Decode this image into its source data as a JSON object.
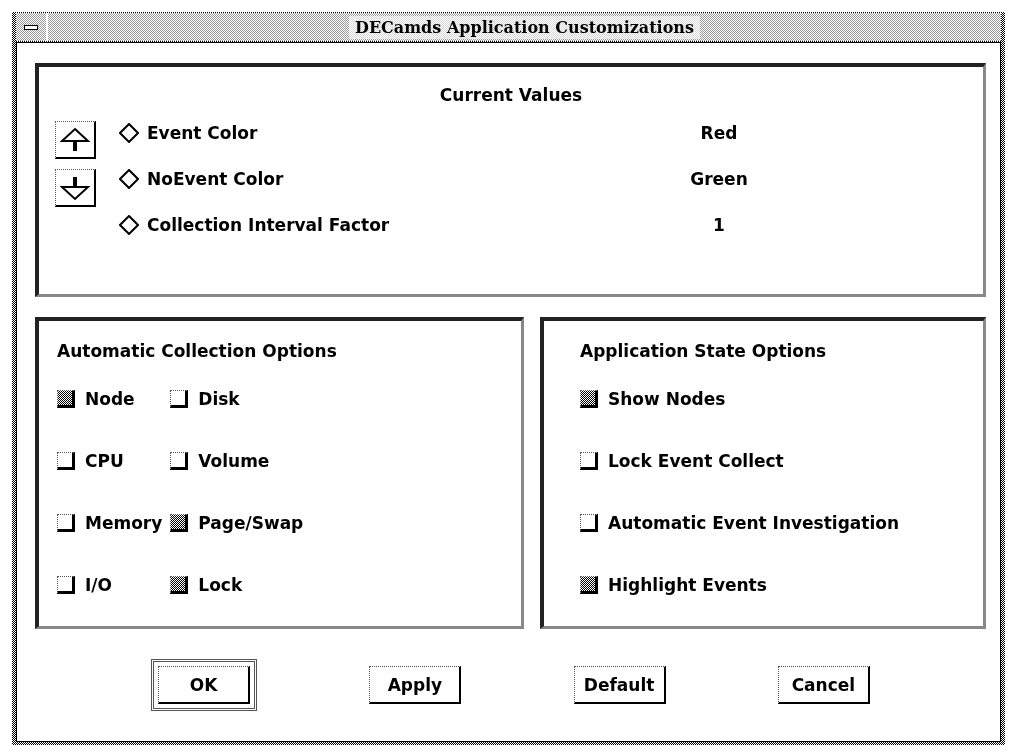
{
  "window": {
    "title": "DECamds Application Customizations"
  },
  "current_values": {
    "title": "Current Values",
    "items": [
      {
        "label": "Event Color",
        "value": "Red",
        "selected": false
      },
      {
        "label": "NoEvent Color",
        "value": "Green",
        "selected": false
      },
      {
        "label": "Collection Interval Factor",
        "value": "1",
        "selected": false
      }
    ]
  },
  "automatic_collection_options": {
    "title": "Automatic Collection Options",
    "columns": [
      [
        {
          "label": "Node",
          "checked": true
        },
        {
          "label": "CPU",
          "checked": false
        },
        {
          "label": "Memory",
          "checked": false
        },
        {
          "label": "I/O",
          "checked": false
        }
      ],
      [
        {
          "label": "Disk",
          "checked": false
        },
        {
          "label": "Volume",
          "checked": false
        },
        {
          "label": "Page/Swap",
          "checked": true
        },
        {
          "label": "Lock",
          "checked": true
        }
      ]
    ]
  },
  "application_state_options": {
    "title": "Application State Options",
    "items": [
      {
        "label": "Show Nodes",
        "checked": true
      },
      {
        "label": "Lock Event Collect",
        "checked": false
      },
      {
        "label": "Automatic Event Investigation",
        "checked": false
      },
      {
        "label": "Highlight Events",
        "checked": true
      }
    ]
  },
  "buttons": [
    {
      "label": "OK",
      "default": true
    },
    {
      "label": "Apply",
      "default": false
    },
    {
      "label": "Default",
      "default": false
    },
    {
      "label": "Cancel",
      "default": false
    }
  ]
}
